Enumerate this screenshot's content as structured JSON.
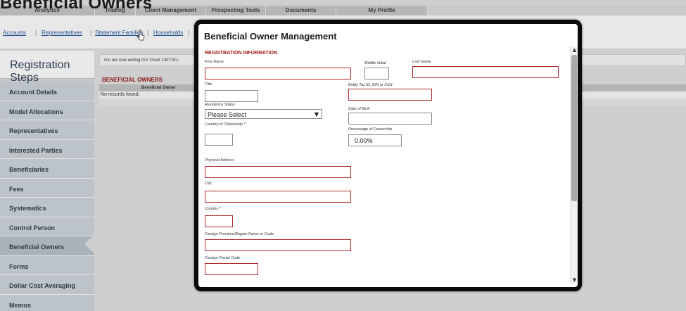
{
  "page_heading": "Beneficial Owners",
  "top_nav": [
    "Analytics",
    "Trading",
    "Client Management",
    "Prospecting Tools",
    "Documents",
    "My Profile"
  ],
  "sub_nav": [
    "Accounts",
    "Representatives",
    "Statement Families",
    "Households"
  ],
  "sidebar": {
    "title": "Registration Steps",
    "items": [
      "Account Details",
      "Model Allocations",
      "Representatives",
      "Interested Parties",
      "Beneficiaries",
      "Fees",
      "Systematics",
      "Control Person",
      "Beneficial Owners",
      "Forms",
      "Dollar Cost Averaging",
      "Memos"
    ],
    "active": "Beneficial Owners"
  },
  "content": {
    "notice": "You are now editing IVV Client 130718's",
    "section_heading": "BENEFICIAL OWNERS",
    "table_header": "Beneficial Owner",
    "empty_message": "No records found."
  },
  "modal": {
    "title": "Beneficial Owner Management",
    "section": "REGISTRATION INFORMATION",
    "labels": {
      "first_name": "First Name",
      "middle_initial": "Middle Initial",
      "last_name": "Last Name",
      "title": "Title",
      "tax_id": "Entity Tax ID, EIN or SSN",
      "residence_status": "Residence Status",
      "date_of_birth": "Date of Birth",
      "country_of_citizenship": "Country of Citizenship *",
      "percentage_of_ownership": "Percentage of Ownership",
      "physical_address": "Physical Address",
      "city": "City",
      "country": "Country *",
      "foreign_province": "Foreign Province/Region Name or Code",
      "foreign_postal_code": "Foreign Postal Code"
    },
    "residence_status_value": "Please Select",
    "percentage_value": "0.00%"
  },
  "icons": {
    "select_arrow": "▼",
    "scroll_up": "▲",
    "scroll_down": "▼"
  }
}
